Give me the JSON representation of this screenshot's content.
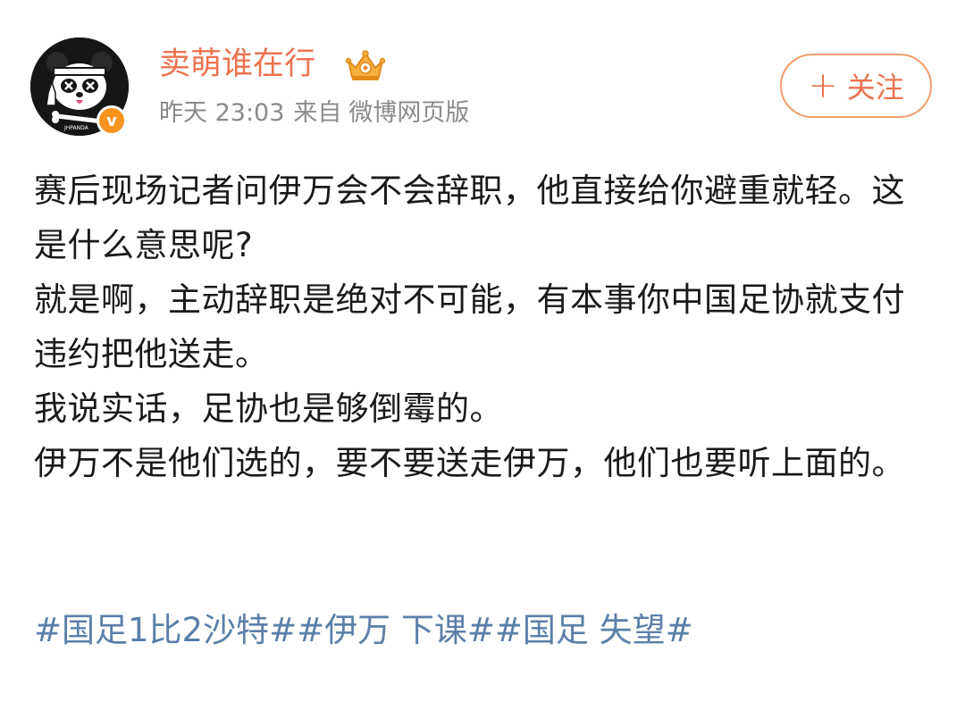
{
  "user": {
    "name": "卖萌谁在行",
    "crown_badge_icon": "crown-badge-icon",
    "verified_icon": "verified-v-icon",
    "avatar_icon": "panda-avatar-icon"
  },
  "meta": {
    "time": "昨天 23:03",
    "source_prefix": "来自",
    "source": "微博网页版"
  },
  "follow_button": {
    "plus": "+",
    "label": "关注"
  },
  "content": {
    "paragraphs": [
      "赛后现场记者问伊万会不会辞职，他直接给你避重就轻。这是什么意思呢?",
      "就是啊，主动辞职是绝对不可能，有本事你中国足协就支付违约把他送走。",
      "我说实话，足协也是够倒霉的。",
      "伊万不是他们选的，要不要送走伊万，他们也要听上面的。"
    ]
  },
  "hashtags": [
    "#国足1比2沙特#",
    "#伊万 下课#",
    "#国足 失望#"
  ],
  "colors": {
    "username": "#eb7350",
    "meta": "#8a8a8a",
    "follow": "#eb7350",
    "follow_border": "#f29e6b",
    "hashtag": "#5b7fa9",
    "verified": "#f7931e"
  }
}
